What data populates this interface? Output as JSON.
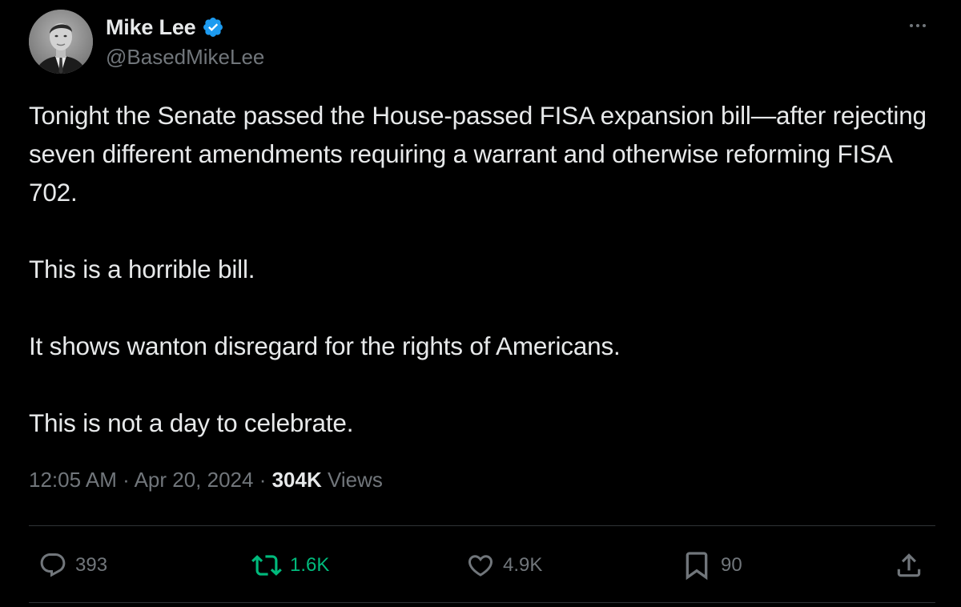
{
  "author": {
    "display_name": "Mike Lee",
    "handle": "@BasedMikeLee",
    "verified": true,
    "verified_color": "#1d9bf0"
  },
  "tweet": {
    "paragraphs": [
      "Tonight the Senate passed the House-passed FISA expansion bill—after rejecting seven different amendments requiring a warrant and otherwise reforming FISA 702.",
      "This is a horrible bill.",
      "It shows wanton disregard for the rights of Americans.",
      "This is not a day to celebrate."
    ],
    "time": "12:05 AM",
    "date": "Apr 20, 2024",
    "views_count": "304K",
    "views_label": "Views",
    "separator": "·"
  },
  "actions": {
    "replies": "393",
    "retweets": "1.6K",
    "likes": "4.9K",
    "bookmarks": "90"
  },
  "colors": {
    "background": "#000000",
    "text": "#e7e9ea",
    "muted": "#71767b",
    "retweet_active": "#00ba7c",
    "divider": "#2f3336"
  },
  "icons": [
    "verified-badge-icon",
    "more-icon",
    "reply-icon",
    "retweet-icon",
    "like-icon",
    "bookmark-icon",
    "share-icon"
  ]
}
